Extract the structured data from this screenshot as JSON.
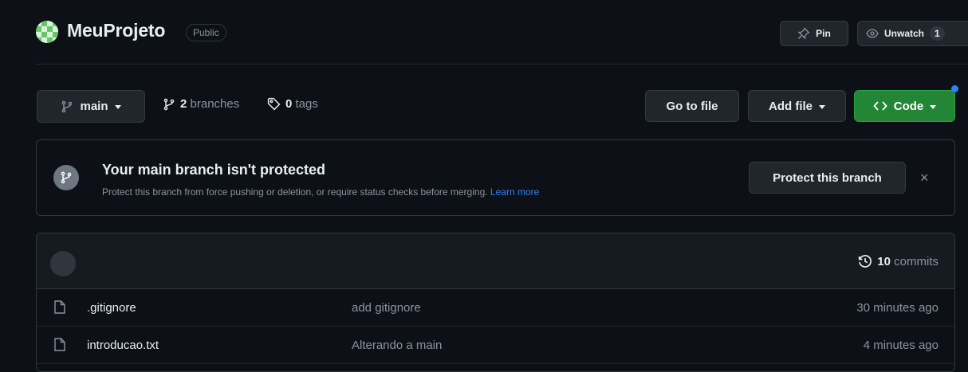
{
  "repo": {
    "name": "MeuProjeto",
    "visibility": "Public",
    "pin_label": "Pin",
    "watch_label": "Unwatch",
    "watch_count": "1"
  },
  "toolbar": {
    "branch": "main",
    "branches_count": "2",
    "branches_label": "branches",
    "tags_count": "0",
    "tags_label": "tags",
    "go_to_file": "Go to file",
    "add_file": "Add file",
    "code": "Code"
  },
  "banner": {
    "title": "Your main branch isn't protected",
    "description": "Protect this branch from force pushing or deletion, or require status checks before merging.",
    "link": "Learn more",
    "button": "Protect this branch",
    "close": "×"
  },
  "files": {
    "commits_count": "10",
    "commits_label": "commits",
    "rows": [
      {
        "name": ".gitignore",
        "message": "add gitignore",
        "time": "30 minutes ago"
      },
      {
        "name": "introducao.txt",
        "message": "Alterando a main",
        "time": "4 minutes ago"
      }
    ]
  },
  "colors": {
    "background": "#0d1117",
    "accent_green": "#238636",
    "link_blue": "#2f81f7"
  }
}
